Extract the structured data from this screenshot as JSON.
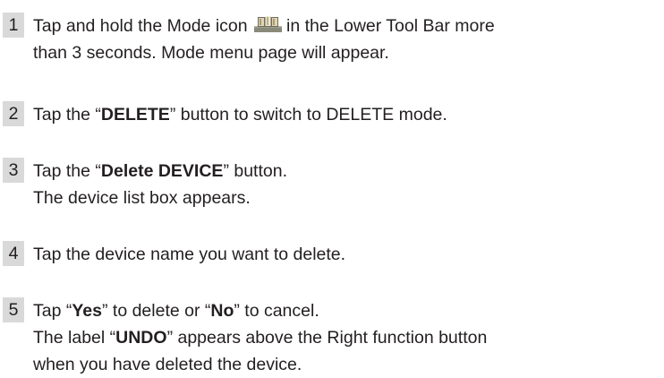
{
  "steps": [
    {
      "number": "1",
      "line1_before_icon": "Tap and hold the Mode icon",
      "line1_after_icon": "in the Lower Tool Bar more",
      "line2": "than 3 seconds. Mode menu page will appear.",
      "icon": "mode-icon"
    },
    {
      "number": "2",
      "before": "Tap the “",
      "bold": "DELETE",
      "after": "” button to switch to DELETE mode.",
      "trailing_mark": "ˌ"
    },
    {
      "number": "3",
      "before": "Tap the “",
      "bold": "Delete DEVICE",
      "after": "” button.",
      "line2": "The device list box appears."
    },
    {
      "number": "4",
      "text": "Tap the device name you want to delete."
    },
    {
      "number": "5",
      "part1": "Tap “",
      "bold1": "Yes",
      "part2": "” to delete or “",
      "bold2": "No",
      "part3": "” to cancel.",
      "line2_before": "The label “",
      "line2_bold": "UNDO",
      "line2_after": "” appears above the Right function button",
      "line3": "when you have deleted the device."
    }
  ],
  "colors": {
    "text": "#231f20",
    "number_box": "#d9d9d9",
    "icon_base": "#8a8a7a",
    "icon_panel": "#e0d6b4"
  }
}
